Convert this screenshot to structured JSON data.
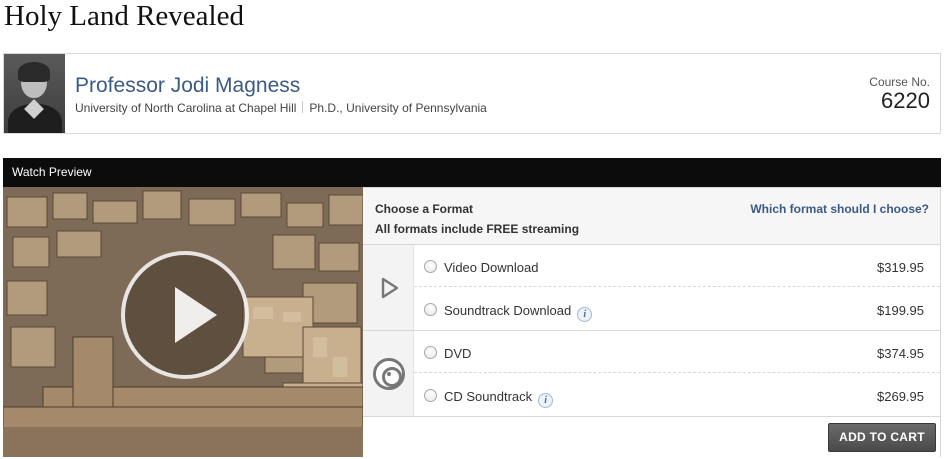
{
  "course": {
    "title": "Holy Land Revealed",
    "course_no_label": "Course No.",
    "course_no": "6220"
  },
  "professor": {
    "name": "Professor Jodi Magness",
    "institution": "University of North Carolina at Chapel Hill",
    "degree": "Ph.D., University of Pennsylvania"
  },
  "preview": {
    "label": "Watch Preview"
  },
  "formats": {
    "choose_label": "Choose a Format",
    "streaming_label": "All formats include FREE streaming",
    "help_link": "Which format should I choose?",
    "info_glyph": "i",
    "groups": [
      {
        "icon": "play-outline-icon",
        "options": [
          {
            "label": "Video Download",
            "price": "$319.95",
            "info": false
          },
          {
            "label": "Soundtrack Download",
            "price": "$199.95",
            "info": true
          }
        ]
      },
      {
        "icon": "disc-icon",
        "options": [
          {
            "label": "DVD",
            "price": "$374.95",
            "info": false
          },
          {
            "label": "CD Soundtrack",
            "price": "$269.95",
            "info": true
          }
        ]
      }
    ],
    "add_to_cart": "ADD TO CART"
  },
  "colors": {
    "link_blue": "#3b5a86",
    "preview_bar": "#0c0c0c",
    "button_gray": "#555555"
  }
}
